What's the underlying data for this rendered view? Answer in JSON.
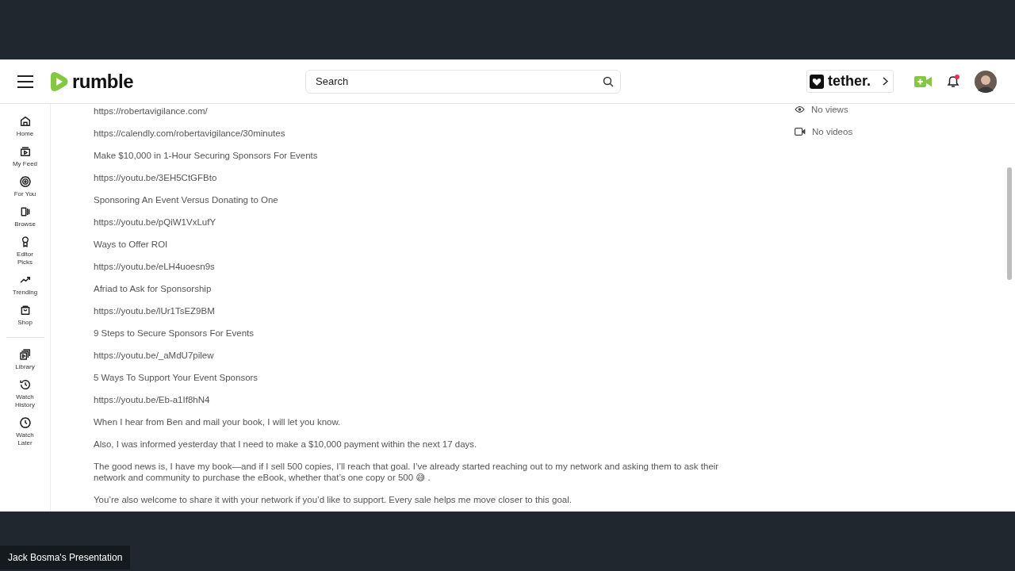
{
  "header": {
    "logo": "rumble",
    "search": {
      "placeholder": "Search"
    },
    "sponsor": {
      "label": "tether."
    },
    "notifications": {
      "unread": true
    }
  },
  "sidebar": {
    "sections": [
      [
        {
          "label": "Home"
        },
        {
          "label": "My Feed"
        },
        {
          "label": "For You"
        },
        {
          "label": "Browse"
        },
        {
          "label": "Editor Picks"
        },
        {
          "label": "Trending"
        },
        {
          "label": "Shop"
        }
      ],
      [
        {
          "label": "Library"
        },
        {
          "label": "Watch History"
        },
        {
          "label": "Watch Later"
        }
      ]
    ]
  },
  "description": [
    {
      "kind": "link",
      "text": "https://robertavigilance.com/"
    },
    {
      "kind": "link",
      "text": "https://calendly.com/robertavigilance/30minutes"
    },
    {
      "kind": "text",
      "text": "Make $10,000 in 1-Hour Securing Sponsors For Events"
    },
    {
      "kind": "link",
      "text": "https://youtu.be/3EH5CtGFBto"
    },
    {
      "kind": "text",
      "text": "Sponsoring An Event Versus Donating to One"
    },
    {
      "kind": "link",
      "text": "https://youtu.be/pQiW1VxLufY"
    },
    {
      "kind": "text",
      "text": "Ways to Offer ROI"
    },
    {
      "kind": "link",
      "text": "https://youtu.be/eLH4uoesn9s"
    },
    {
      "kind": "text",
      "text": "Afriad to Ask for Sponsorship"
    },
    {
      "kind": "link",
      "text": "https://youtu.be/lUr1TsEZ9BM"
    },
    {
      "kind": "text",
      "text": "9 Steps to Secure Sponsors For Events"
    },
    {
      "kind": "link",
      "text": "https://youtu.be/_aMdU7pilew"
    },
    {
      "kind": "text",
      "text": "5 Ways To Support Your Event Sponsors"
    },
    {
      "kind": "link",
      "text": "https://youtu.be/Eb-a1If8hN4"
    },
    {
      "kind": "text",
      "text": "When I hear from Ben and mail your book, I will let you know."
    },
    {
      "kind": "text",
      "text": "Also, I was informed yesterday that I need to make a $10,000 payment within the next 17 days."
    },
    {
      "kind": "text",
      "text": "The good news is, I have my book—and if I sell 500 copies, I’ll reach that goal. I’ve already started reaching out to my network and asking them to ask their network and community to purchase the eBook, whether that’s one copy or 500 😅 ."
    },
    {
      "kind": "text",
      "text": "You’re also welcome to share it with your network if you’d like to support. Every sale helps me move closer to this goal."
    }
  ],
  "channel_stats": [
    {
      "kind": "views",
      "text": "No views"
    },
    {
      "kind": "videos",
      "text": "No videos"
    }
  ],
  "presenter_label": "Jack Bosma's Presentation"
}
